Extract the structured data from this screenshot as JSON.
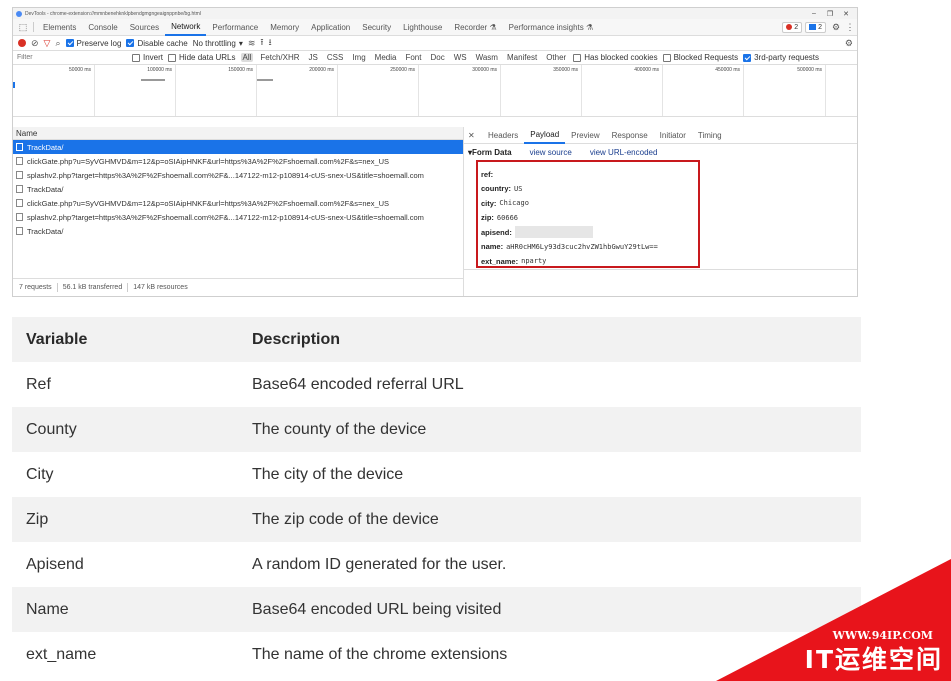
{
  "devtools": {
    "window_title": "DevTools - chrome-extension://mmnbenehknklpbendgmgngeaignppnbe/bg.html",
    "main_tabs": [
      "Elements",
      "Console",
      "Sources",
      "Network",
      "Performance",
      "Memory",
      "Application",
      "Security",
      "Lighthouse",
      "Recorder",
      "Performance insights"
    ],
    "active_main_tab": "Network",
    "error_count": "2",
    "message_count": "2",
    "toolbar": {
      "preserve_log": "Preserve log",
      "disable_cache": "Disable cache",
      "throttling": "No throttling"
    },
    "filter": {
      "placeholder": "Filter",
      "invert": "Invert",
      "hide_data_urls": "Hide data URLs",
      "types": [
        "All",
        "Fetch/XHR",
        "JS",
        "CSS",
        "Img",
        "Media",
        "Font",
        "Doc",
        "WS",
        "Wasm",
        "Manifest",
        "Other"
      ],
      "has_blocked_cookies": "Has blocked cookies",
      "blocked_requests": "Blocked Requests",
      "third_party": "3rd-party requests"
    },
    "timeline_ticks": [
      "50000 ms",
      "100000 ms",
      "150000 ms",
      "200000 ms",
      "250000 ms",
      "300000 ms",
      "350000 ms",
      "400000 ms",
      "450000 ms",
      "500000 ms"
    ],
    "requests_header": "Name",
    "requests": [
      "TrackData/",
      "clickGate.php?u=SyVGHMVD&m=12&p=oSIAipHNKF&url=https%3A%2F%2Fshoemall.com%2F&s=nex_US",
      "splashv2.php?target=https%3A%2F%2Fshoemall.com%2F&...147122-m12-p108914-cUS-snex-US&title=shoemall.com",
      "TrackData/",
      "clickGate.php?u=SyVGHMVD&m=12&p=oSIAipHNKF&url=https%3A%2F%2Fshoemall.com%2F&s=nex_US",
      "splashv2.php?target=https%3A%2F%2Fshoemall.com%2F&...147122-m12-p108914-cUS-snex-US&title=shoemall.com",
      "TrackData/"
    ],
    "status": {
      "requests": "7 requests",
      "transferred": "56.1 kB transferred",
      "resources": "147 kB resources"
    },
    "detail_tabs": [
      "Headers",
      "Payload",
      "Preview",
      "Response",
      "Initiator",
      "Timing"
    ],
    "active_detail_tab": "Payload",
    "form_data": {
      "title": "Form Data",
      "view_source": "view source",
      "view_url_encoded": "view URL-encoded",
      "fields": [
        {
          "key": "ref:",
          "value": ""
        },
        {
          "key": "country:",
          "value": "US"
        },
        {
          "key": "city:",
          "value": "Chicago"
        },
        {
          "key": "zip:",
          "value": "60666"
        },
        {
          "key": "apisend:",
          "value": ""
        },
        {
          "key": "name:",
          "value": "aHR0cHM6Ly93d3cuc2hvZW1hbGwuY29tLw=="
        },
        {
          "key": "ext_name:",
          "value": "nparty"
        }
      ]
    }
  },
  "table": {
    "headers": [
      "Variable",
      "Description"
    ],
    "rows": [
      [
        "Ref",
        "Base64 encoded referral URL"
      ],
      [
        "County",
        "The county of the device"
      ],
      [
        "City",
        "The city of the device"
      ],
      [
        "Zip",
        "The zip code of the device"
      ],
      [
        "Apisend",
        "A random ID generated for the user."
      ],
      [
        "Name",
        "Base64 encoded URL being visited"
      ],
      [
        "ext_name",
        "The name of the chrome extensions"
      ]
    ]
  },
  "watermark": {
    "url": "WWW.94IP.COM",
    "brand": "IT运维空间",
    "color": "#e8141b"
  },
  "colors": {
    "accent": "#1a73e8",
    "highlight_box": "#c8191d",
    "row_stripe": "#f2f2f2"
  }
}
